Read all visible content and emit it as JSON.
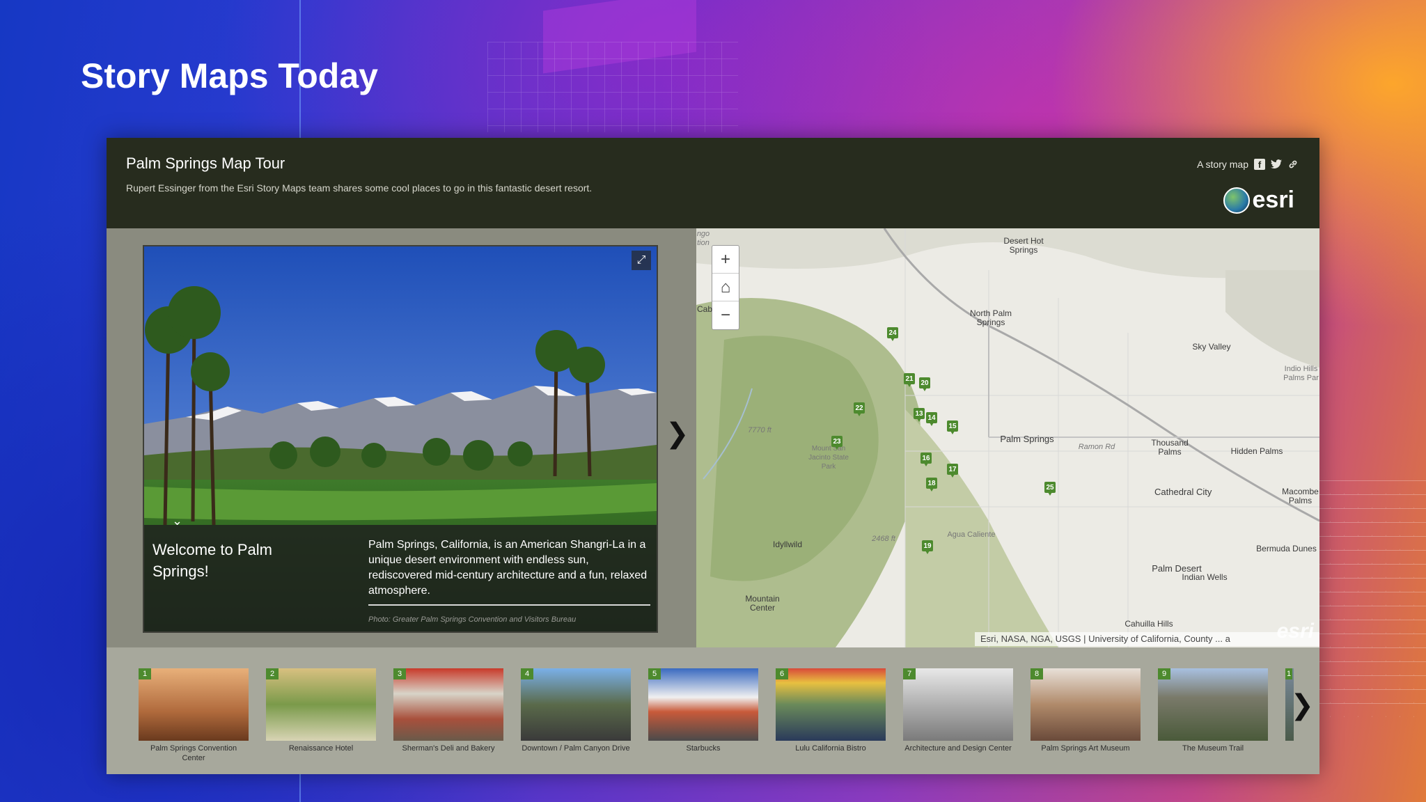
{
  "slide": {
    "title": "Story Maps Today"
  },
  "header": {
    "title": "Palm Springs Map Tour",
    "subtitle": "Rupert Essinger from the Esri Story Maps team shares some cool places to go in this fantastic desert resort.",
    "share_label": "A story map",
    "share_icons": [
      "facebook-icon",
      "twitter-icon",
      "link-icon"
    ],
    "logo_text": "esri"
  },
  "media": {
    "caption_title": "Welcome to Palm Springs!",
    "caption_text": "Palm Springs, California, is an American Shangri-La in a unique desert environment with endless sun, rediscovered mid-century architecture and a fun, relaxed atmosphere.",
    "credit": "Photo: Greater Palm Springs Convention and Visitors Bureau"
  },
  "map": {
    "zoom_in": "+",
    "home": "⌂",
    "zoom_out": "−",
    "labels": {
      "desert_hot_springs": "Desert Hot Springs",
      "north_palm_springs": "North Palm Springs",
      "sky_valley": "Sky Valley",
      "indio_hills": "Indio Hills Palms Par",
      "palm_springs": "Palm Springs",
      "ramon_rd": "Ramon Rd",
      "thousand_palms": "Thousand Palms",
      "hidden_palms": "Hidden Palms",
      "mount_san_jacinto": "Mount San Jacinto State Park",
      "cathedral_city": "Cathedral City",
      "macombe_palms": "Macombe Palms",
      "idyllwild": "Idyllwild",
      "agua_caliente": "Agua Caliente",
      "bermuda_dunes": "Bermuda Dunes",
      "palm_desert": "Palm Desert",
      "indian_wells": "Indian Wells",
      "mountain_center": "Mountain Center",
      "cahuilla_hills": "Cahuilla Hills",
      "elev_7770": "7770 ft",
      "elev_2468": "2468 ft",
      "cab": "Cab",
      "ingo": "ngo tion"
    },
    "markers": [
      "24",
      "21",
      "20",
      "22",
      "13",
      "14",
      "15",
      "23",
      "16",
      "17",
      "18",
      "25",
      "19"
    ],
    "attribution": "Esri, NASA, NGA, USGS | University of California, County ... a",
    "watermark": "esri"
  },
  "carousel": {
    "items": [
      {
        "num": "1",
        "label": "Palm Springs Convention Center",
        "color": "#b06a3c"
      },
      {
        "num": "2",
        "label": "Renaissance Hotel",
        "color": "#7a9a4a"
      },
      {
        "num": "3",
        "label": "Sherman's Deli and Bakery",
        "color": "#a8503c"
      },
      {
        "num": "4",
        "label": "Downtown / Palm Canyon Drive",
        "color": "#5a6a7a"
      },
      {
        "num": "5",
        "label": "Starbucks",
        "color": "#6a8ab0"
      },
      {
        "num": "6",
        "label": "Lulu California Bistro",
        "color": "#8a6a3a"
      },
      {
        "num": "7",
        "label": "Architecture and Design Center",
        "color": "#9a9a9a"
      },
      {
        "num": "8",
        "label": "Palm Springs Art Museum",
        "color": "#b08a6a"
      },
      {
        "num": "9",
        "label": "The Museum Trail",
        "color": "#5a6a5a"
      },
      {
        "num": "1",
        "label": "",
        "color": "#5a6a5a"
      }
    ]
  }
}
